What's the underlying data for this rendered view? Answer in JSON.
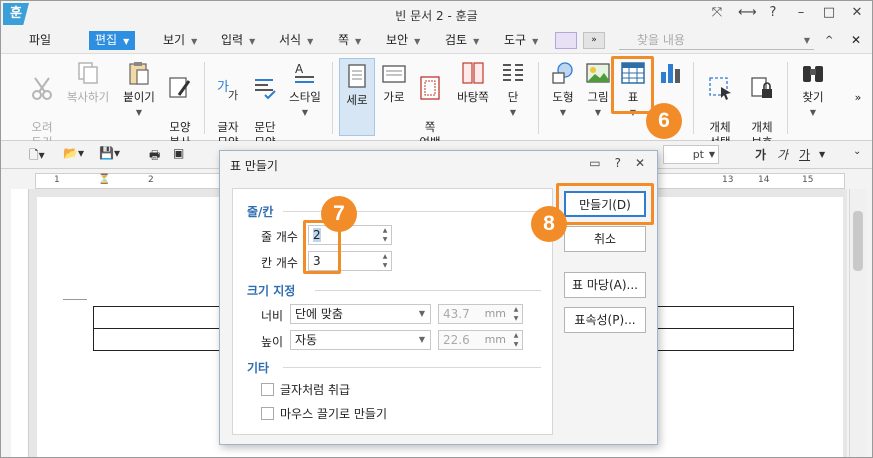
{
  "window": {
    "app_logo": "훈",
    "title": "빈 문서 2 - 훈글",
    "controls": [
      "⤧",
      "⟷",
      "?",
      "–",
      "□",
      "✕"
    ]
  },
  "menu": {
    "file": "파일",
    "items": [
      {
        "label": "편집",
        "active": true
      },
      {
        "label": "보기"
      },
      {
        "label": "입력"
      },
      {
        "label": "서식"
      },
      {
        "label": "쪽"
      },
      {
        "label": "보안"
      },
      {
        "label": "검토"
      },
      {
        "label": "도구"
      }
    ],
    "search_placeholder": "찾을 내용",
    "collapse": "^",
    "close": "✕"
  },
  "ribbon": {
    "cut": "오려\n두기",
    "copy": "복사하기",
    "paste": "붙이기",
    "format_copy": "모양\n복사",
    "char_shape": "글자\n모양",
    "para_shape": "문단\n모양",
    "style": "스타일",
    "portrait": "세로",
    "landscape": "가로",
    "page_margin": "쪽\n여백",
    "background": "바탕쪽",
    "column": "단",
    "shape": "도형",
    "picture": "그림",
    "table": "표",
    "chart": "차트",
    "obj_select": "개체\n선택",
    "obj_protect": "개체\n보호",
    "find": "찾기",
    "more": "»"
  },
  "toolbar2": {
    "font_unit": "pt",
    "bold": "가",
    "italic": "가",
    "underline": "가"
  },
  "ruler": {
    "marks": [
      "1",
      "2",
      "13",
      "14",
      "15"
    ]
  },
  "dialog": {
    "title": "표 만들기",
    "section_rows_cols": "줄/칸",
    "rows_label": "줄 개수",
    "rows_value": "2",
    "cols_label": "칸 개수",
    "cols_value": "3",
    "section_size": "크기 지정",
    "width_label": "너비",
    "width_option": "단에 맞춤",
    "width_value": "43.7",
    "height_label": "높이",
    "height_option": "자동",
    "height_value": "22.6",
    "unit": "mm",
    "section_etc": "기타",
    "treat_as_char": "글자처럼 취급",
    "drag_create": "마우스 끌기로 만들기",
    "btn_create": "만들기(D)",
    "btn_cancel": "취소",
    "btn_table_template": "표 마당(A)...",
    "btn_table_props": "표속성(P)..."
  },
  "badges": [
    "6",
    "7",
    "8"
  ],
  "colors": {
    "accent": "#2e8ee0",
    "highlight": "#f28c28",
    "section_text": "#2f6db2"
  }
}
